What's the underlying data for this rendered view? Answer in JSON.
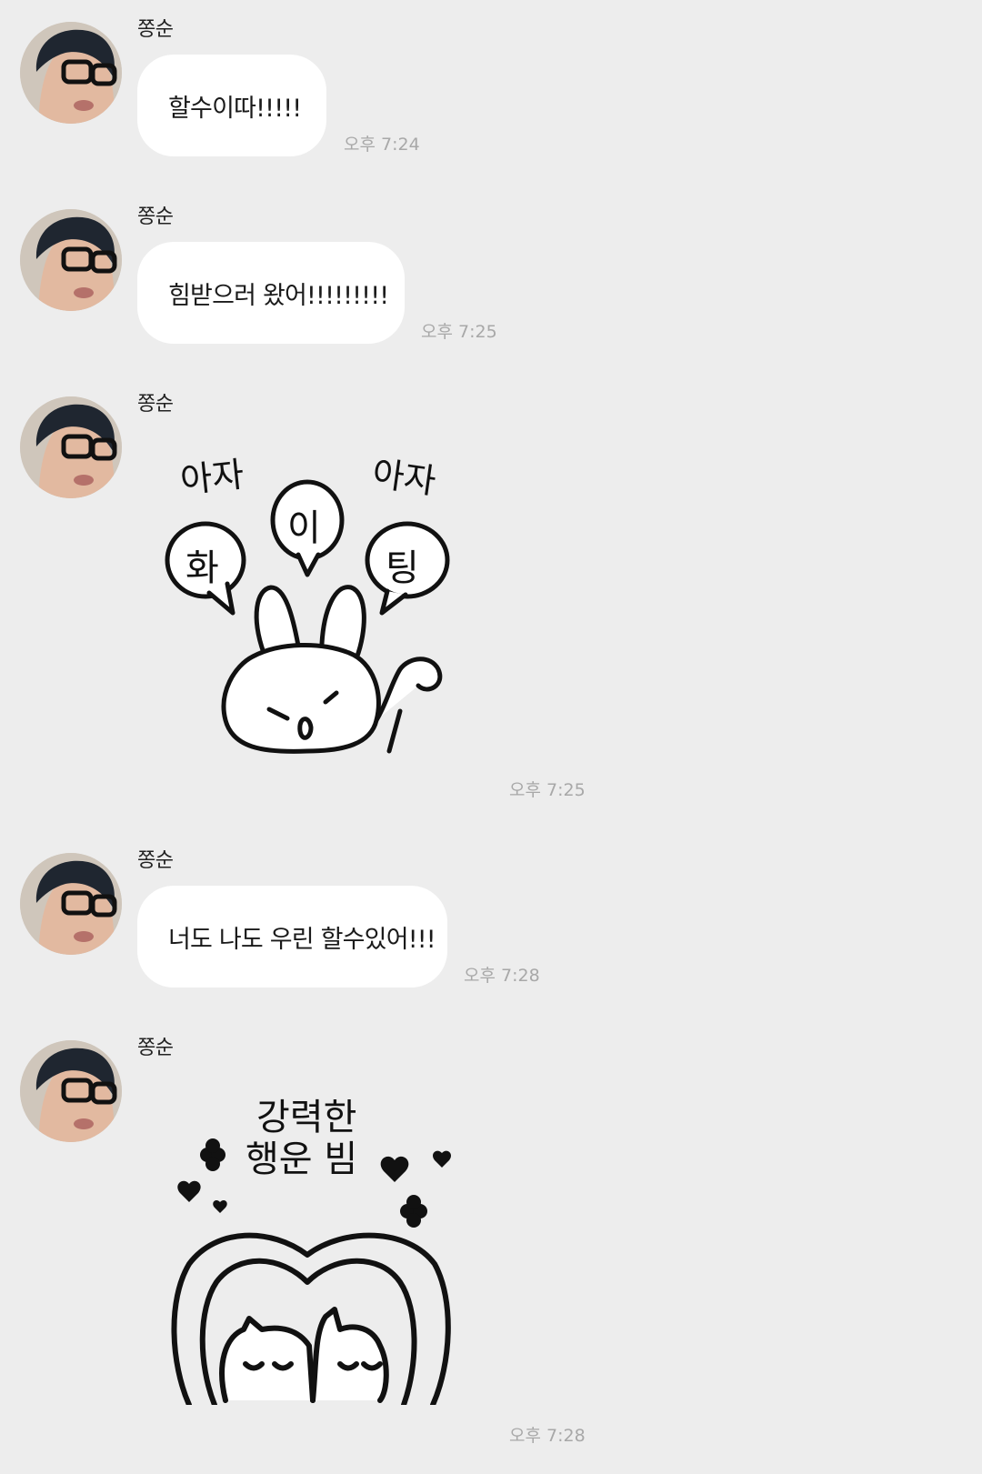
{
  "messages": [
    {
      "type": "text",
      "sender": "쫑순",
      "text": "할수이따!!!!!",
      "time": "오후 7:24"
    },
    {
      "type": "text",
      "sender": "쫑순",
      "text": "힘받으러 왔어!!!!!!!!!",
      "time": "오후 7:25"
    },
    {
      "type": "sticker",
      "sender": "쫑순",
      "sticker_text": [
        "아자",
        "화",
        "이",
        "아자",
        "팅"
      ],
      "time": "오후 7:25"
    },
    {
      "type": "text",
      "sender": "쫑순",
      "text": "너도 나도 우린 할수있어!!!",
      "time": "오후 7:28"
    },
    {
      "type": "sticker",
      "sender": "쫑순",
      "sticker_text": [
        "강력한",
        "행운 빔"
      ],
      "time": "오후 7:28"
    }
  ],
  "colors": {
    "background": "#ededed",
    "bubble": "#ffffff",
    "time": "#a8a8a8"
  }
}
